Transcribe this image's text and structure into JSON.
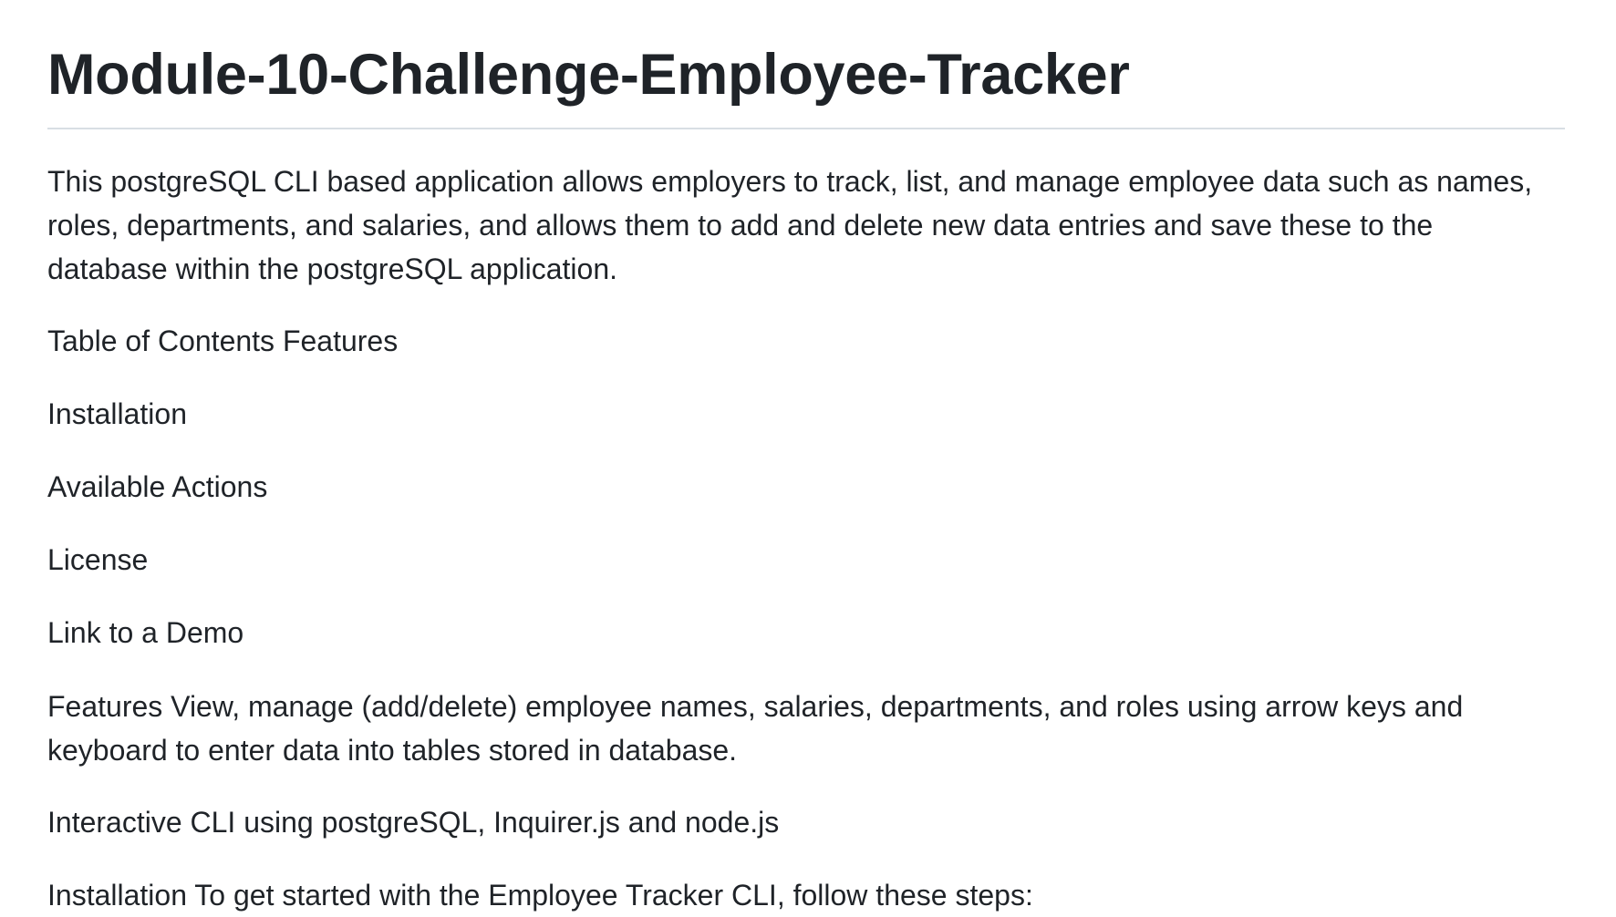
{
  "readme": {
    "title": "Module-10-Challenge-Employee-Tracker",
    "intro_lines": [
      "This postgreSQL CLI based application allows employers to track, list, and manage employee data such as names,",
      "roles, departments, and salaries, and allows them to add and delete new data entries and save these to the",
      "database within the postgreSQL application."
    ],
    "toc_heading": "Table of Contents Features",
    "toc_items": [
      "Installation",
      "Available Actions",
      "License",
      "Link to a Demo"
    ],
    "features_lines": [
      "Features View, manage (add/delete) employee names, salaries, departments, and roles using arrow keys and",
      "keyboard to enter data into tables stored in database."
    ],
    "cli_line": "Interactive CLI using postgreSQL, Inquirer.js and node.js",
    "installation_line": "Installation To get started with the Employee Tracker CLI, follow these steps:"
  }
}
